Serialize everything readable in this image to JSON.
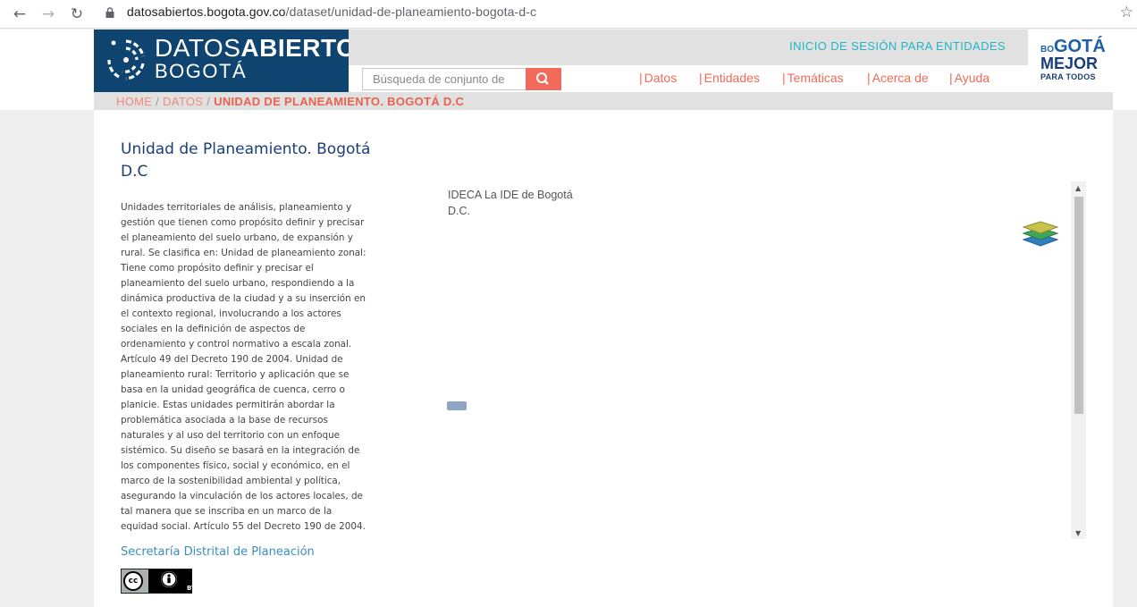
{
  "browser": {
    "url_host": "datosabiertos.bogota.gov.co",
    "url_path": "/dataset/unidad-de-planeamiento-bogota-d-c"
  },
  "header": {
    "logo_line1_thin": "DATOS",
    "logo_line1_bold": "ABIERTOS",
    "logo_line2": "BOGOTÁ",
    "login_link": "INICIO DE SESIÓN PARA ENTIDADES",
    "brand_line1_small": "BO",
    "brand_line1_rest": "GOTÁ",
    "brand_line2": "MEJOR",
    "brand_line3": "PARA TODOS",
    "search_placeholder": "Búsqueda de conjunto de",
    "menu": [
      {
        "label": "Datos"
      },
      {
        "label": "Entidades"
      },
      {
        "label": "Temáticas"
      },
      {
        "label": "Acerca de"
      },
      {
        "label": "Ayuda"
      }
    ]
  },
  "breadcrumb": {
    "home": "HOME",
    "datos": "DATOS",
    "current": "UNIDAD DE PLANEAMIENTO. BOGOTÁ D.C"
  },
  "dataset": {
    "title": "Unidad de Planeamiento. Bogotá D.C",
    "description": "Unidades territoriales de análisis, planeamiento y gestión que tienen como propósito definir y precisar el planeamiento del suelo urbano, de expansión y rural. Se clasifica en: Unidad de planeamiento zonal: Tiene como propósito definir y precisar el planeamiento del suelo urbano, respondiendo a la dinámica productiva de la ciudad y a su inserción en el contexto regional, involucrando a los actores sociales en la definición de aspectos de ordenamiento y control normativo a escala zonal. Artículo 49 del Decreto 190 de 2004. Unidad de planeamiento rural: Territorio y aplicación que se basa en la unidad geográfica de cuenca, cerro o planicie. Estas unidades permitirán abordar la problemática asociada a la base de recursos naturales y al uso del territorio con un enfoque sistémico. Su diseño se basará en la integración de los componentes físico, social y económico, en el marco de la sostenibilidad ambiental y política, asegurando la vinculación de los actores locales, de tal manera que se inscriba en un marco de la equidad social. Artículo 55 del Decreto 190 de 2004.",
    "publisher": "Secretaría Distrital de Planeación",
    "license_cc": "cc",
    "license_by": "BY"
  },
  "map": {
    "attribution": "IDECA La IDE de Bogotá D.C.",
    "layers_icon": "layers-icon"
  }
}
